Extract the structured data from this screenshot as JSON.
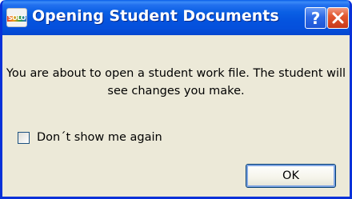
{
  "dialog": {
    "title": "Opening Student Documents",
    "app_icon": {
      "name": "solo-icon",
      "text": "SOLO"
    },
    "help_label": "?",
    "close_icon": "close-icon",
    "message": "You are about to open a student work file. The student will see changes you make.",
    "checkbox": {
      "label": "Don´t show me again",
      "checked": false
    },
    "ok_label": "OK"
  },
  "colors": {
    "title_bar": "#0553de",
    "window_border": "#0831d9",
    "dialog_background": "#ece9d8",
    "close_button": "#e2572f",
    "help_button": "#2d6ae6"
  }
}
